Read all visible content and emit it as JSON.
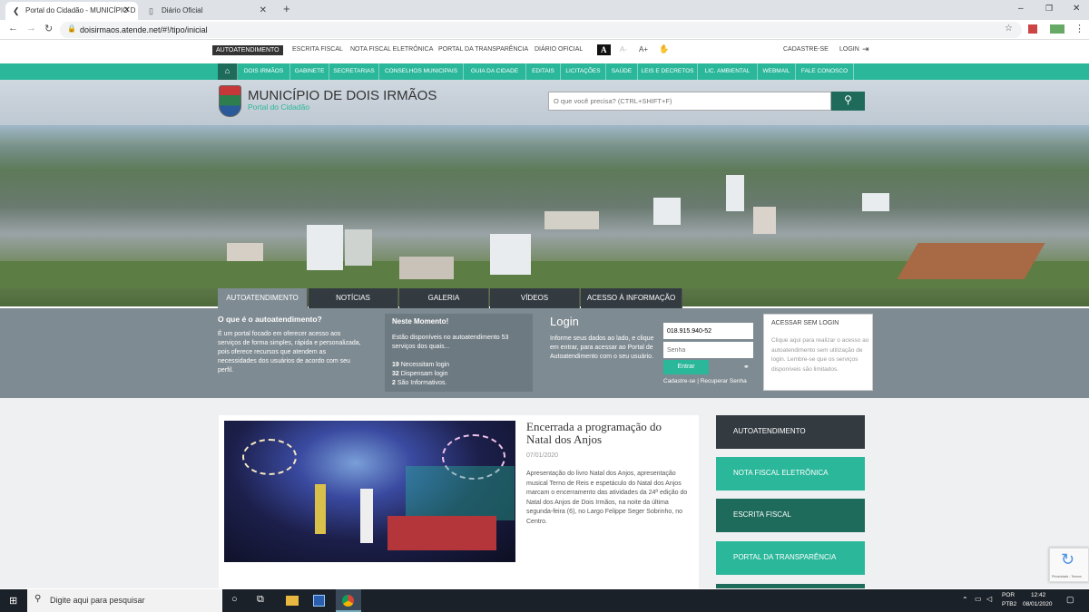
{
  "browser": {
    "tabs": [
      {
        "label": "Portal do Cidadão - MUNICÍPIO D"
      },
      {
        "label": "Diário Oficial"
      }
    ],
    "new_tab": "+",
    "url": "doisirmaos.atende.net/#!/tipo/inicial",
    "window": {
      "min": "–",
      "max": "❐",
      "close": "✕"
    }
  },
  "topbar": {
    "links": [
      "AUTOATENDIMENTO",
      "ESCRITA FISCAL",
      "NOTA FISCAL ELETRÔNICA",
      "PORTAL DA TRANSPARÊNCIA",
      "DIÁRIO OFICIAL"
    ],
    "contrast": "A",
    "font_minus": "A-",
    "font_plus": "A+",
    "cadastre": "CADASTRE-SE",
    "login": "LOGIN"
  },
  "menu": [
    "DOIS IRMÃOS",
    "GABINETE",
    "SECRETARIAS",
    "CONSELHOS MUNICIPAIS",
    "GUIA DA CIDADE",
    "EDITAIS",
    "LICITAÇÕES",
    "SAÚDE",
    "LEIS E DECRETOS",
    "LIC. AMBIENTAL",
    "WEBMAIL",
    "FALE CONOSCO"
  ],
  "header": {
    "title": "MUNICÍPIO DE DOIS IRMÃOS",
    "subtitle": "Portal do Cidadão",
    "search_placeholder": "O que você precisa? (CTRL+SHIFT+F)"
  },
  "hero_tabs": [
    "AUTOATENDIMENTO",
    "NOTÍCIAS",
    "GALERIA",
    "VÍDEOS",
    "ACESSO À INFORMAÇÃO"
  ],
  "auto": {
    "question": "O que é o autoatendimento?",
    "desc": "É um portal focado em oferecer acesso aos serviços de forma simples, rápida e personalizada, pois oferece recursos que atendem as necessidades dos usuários de acordo com seu perfil.",
    "moment_title": "Neste Momento!",
    "moment_text": "Estão disponíveis no autoatendimento 53 serviços dos quais...",
    "stat1_n": "19",
    "stat1_t": "Necessitam login",
    "stat2_n": "32",
    "stat2_t": "Dispensam login",
    "stat3_n": "2",
    "stat3_t": "São Informativos.",
    "login_title": "Login",
    "login_text": "Informe seus dados ao lado, e clique em entrar, para acessar ao Portal de Autoatendimento com o seu usuário.",
    "user_value": "018.915.940-52",
    "password_placeholder": "Senha",
    "enter": "Entrar",
    "cadastre": "Cadastre-se",
    "separator": "|",
    "recover": "Recuperar Senha",
    "nologin_title": "ACESSAR SEM LOGIN",
    "nologin_text": "Clique aqui para realizar o acesso ao autoatendimento sem utilização de login. Lembre-se que os serviços disponíveis são limitados."
  },
  "news": {
    "title": "Encerrada a programação do Natal dos Anjos",
    "date": "07/01/2020",
    "body": "Apresentação do livro Natal dos Anjos, apresentação musical Terno de Reis e espetáculo do Natal dos Anjos marcam o encerramento das atividades da 24ª edição do Natal dos Anjos de Dois Irmãos, na noite da última segunda-feira (6), no Largo Felippe Seger Sobrinho, no Centro."
  },
  "side_buttons": [
    "AUTOATENDIMENTO",
    "NOTA FISCAL ELETRÔNICA",
    "ESCRITA FISCAL",
    "PORTAL DA TRANSPARÊNCIA"
  ],
  "recaptcha": "Privacidade - Termos",
  "taskbar": {
    "search": "Digite aqui para pesquisar",
    "lang1": "POR",
    "lang2": "PTB2",
    "time": "12:42",
    "date": "08/01/2020"
  },
  "colors": {
    "accent": "#2ab79a",
    "dark": "#333b41",
    "grey": "#7f8b92",
    "sidebar_dark": "#1f6b5b"
  }
}
